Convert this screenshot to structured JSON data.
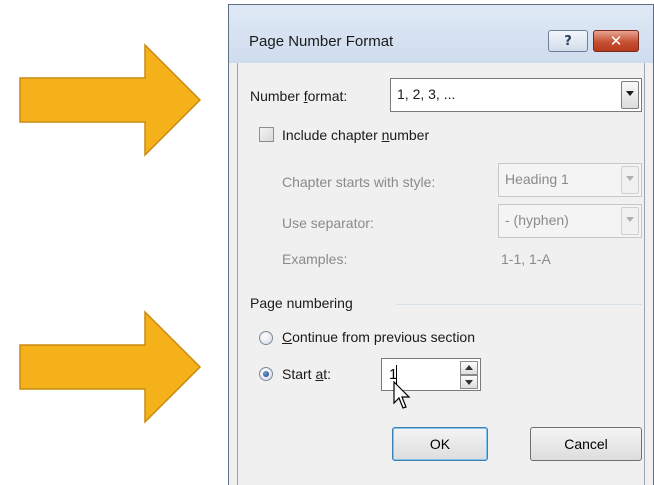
{
  "dialog": {
    "title": "Page Number Format",
    "help_glyph": "?",
    "close_glyph": "✕"
  },
  "number_format": {
    "label_pre": "Number ",
    "label_accel": "f",
    "label_post": "ormat:",
    "value": "1, 2, 3, ..."
  },
  "chapter": {
    "checkbox_pre": "Include chapter ",
    "checkbox_accel": "n",
    "checkbox_post": "umber",
    "checked": false,
    "starts_with_label": "Chapter starts with style:",
    "starts_with_value": "Heading 1",
    "separator_label": "Use separator:",
    "separator_value": "-  (hyphen)",
    "examples_label": "Examples:",
    "examples_value": "1-1, 1-A"
  },
  "page_numbering": {
    "heading": "Page numbering",
    "continue_accel": "C",
    "continue_post": "ontinue from previous section",
    "start_pre": "Start ",
    "start_accel": "a",
    "start_post": "t:",
    "selected": "start_at",
    "start_at_value": "1"
  },
  "buttons": {
    "ok": "OK",
    "cancel": "Cancel"
  },
  "colors": {
    "arrow_fill": "#F5B11A",
    "arrow_stroke": "#C98A12"
  },
  "icons": {
    "arrows": "arrow-right-icon",
    "pointer": "mouse-pointer-icon"
  }
}
